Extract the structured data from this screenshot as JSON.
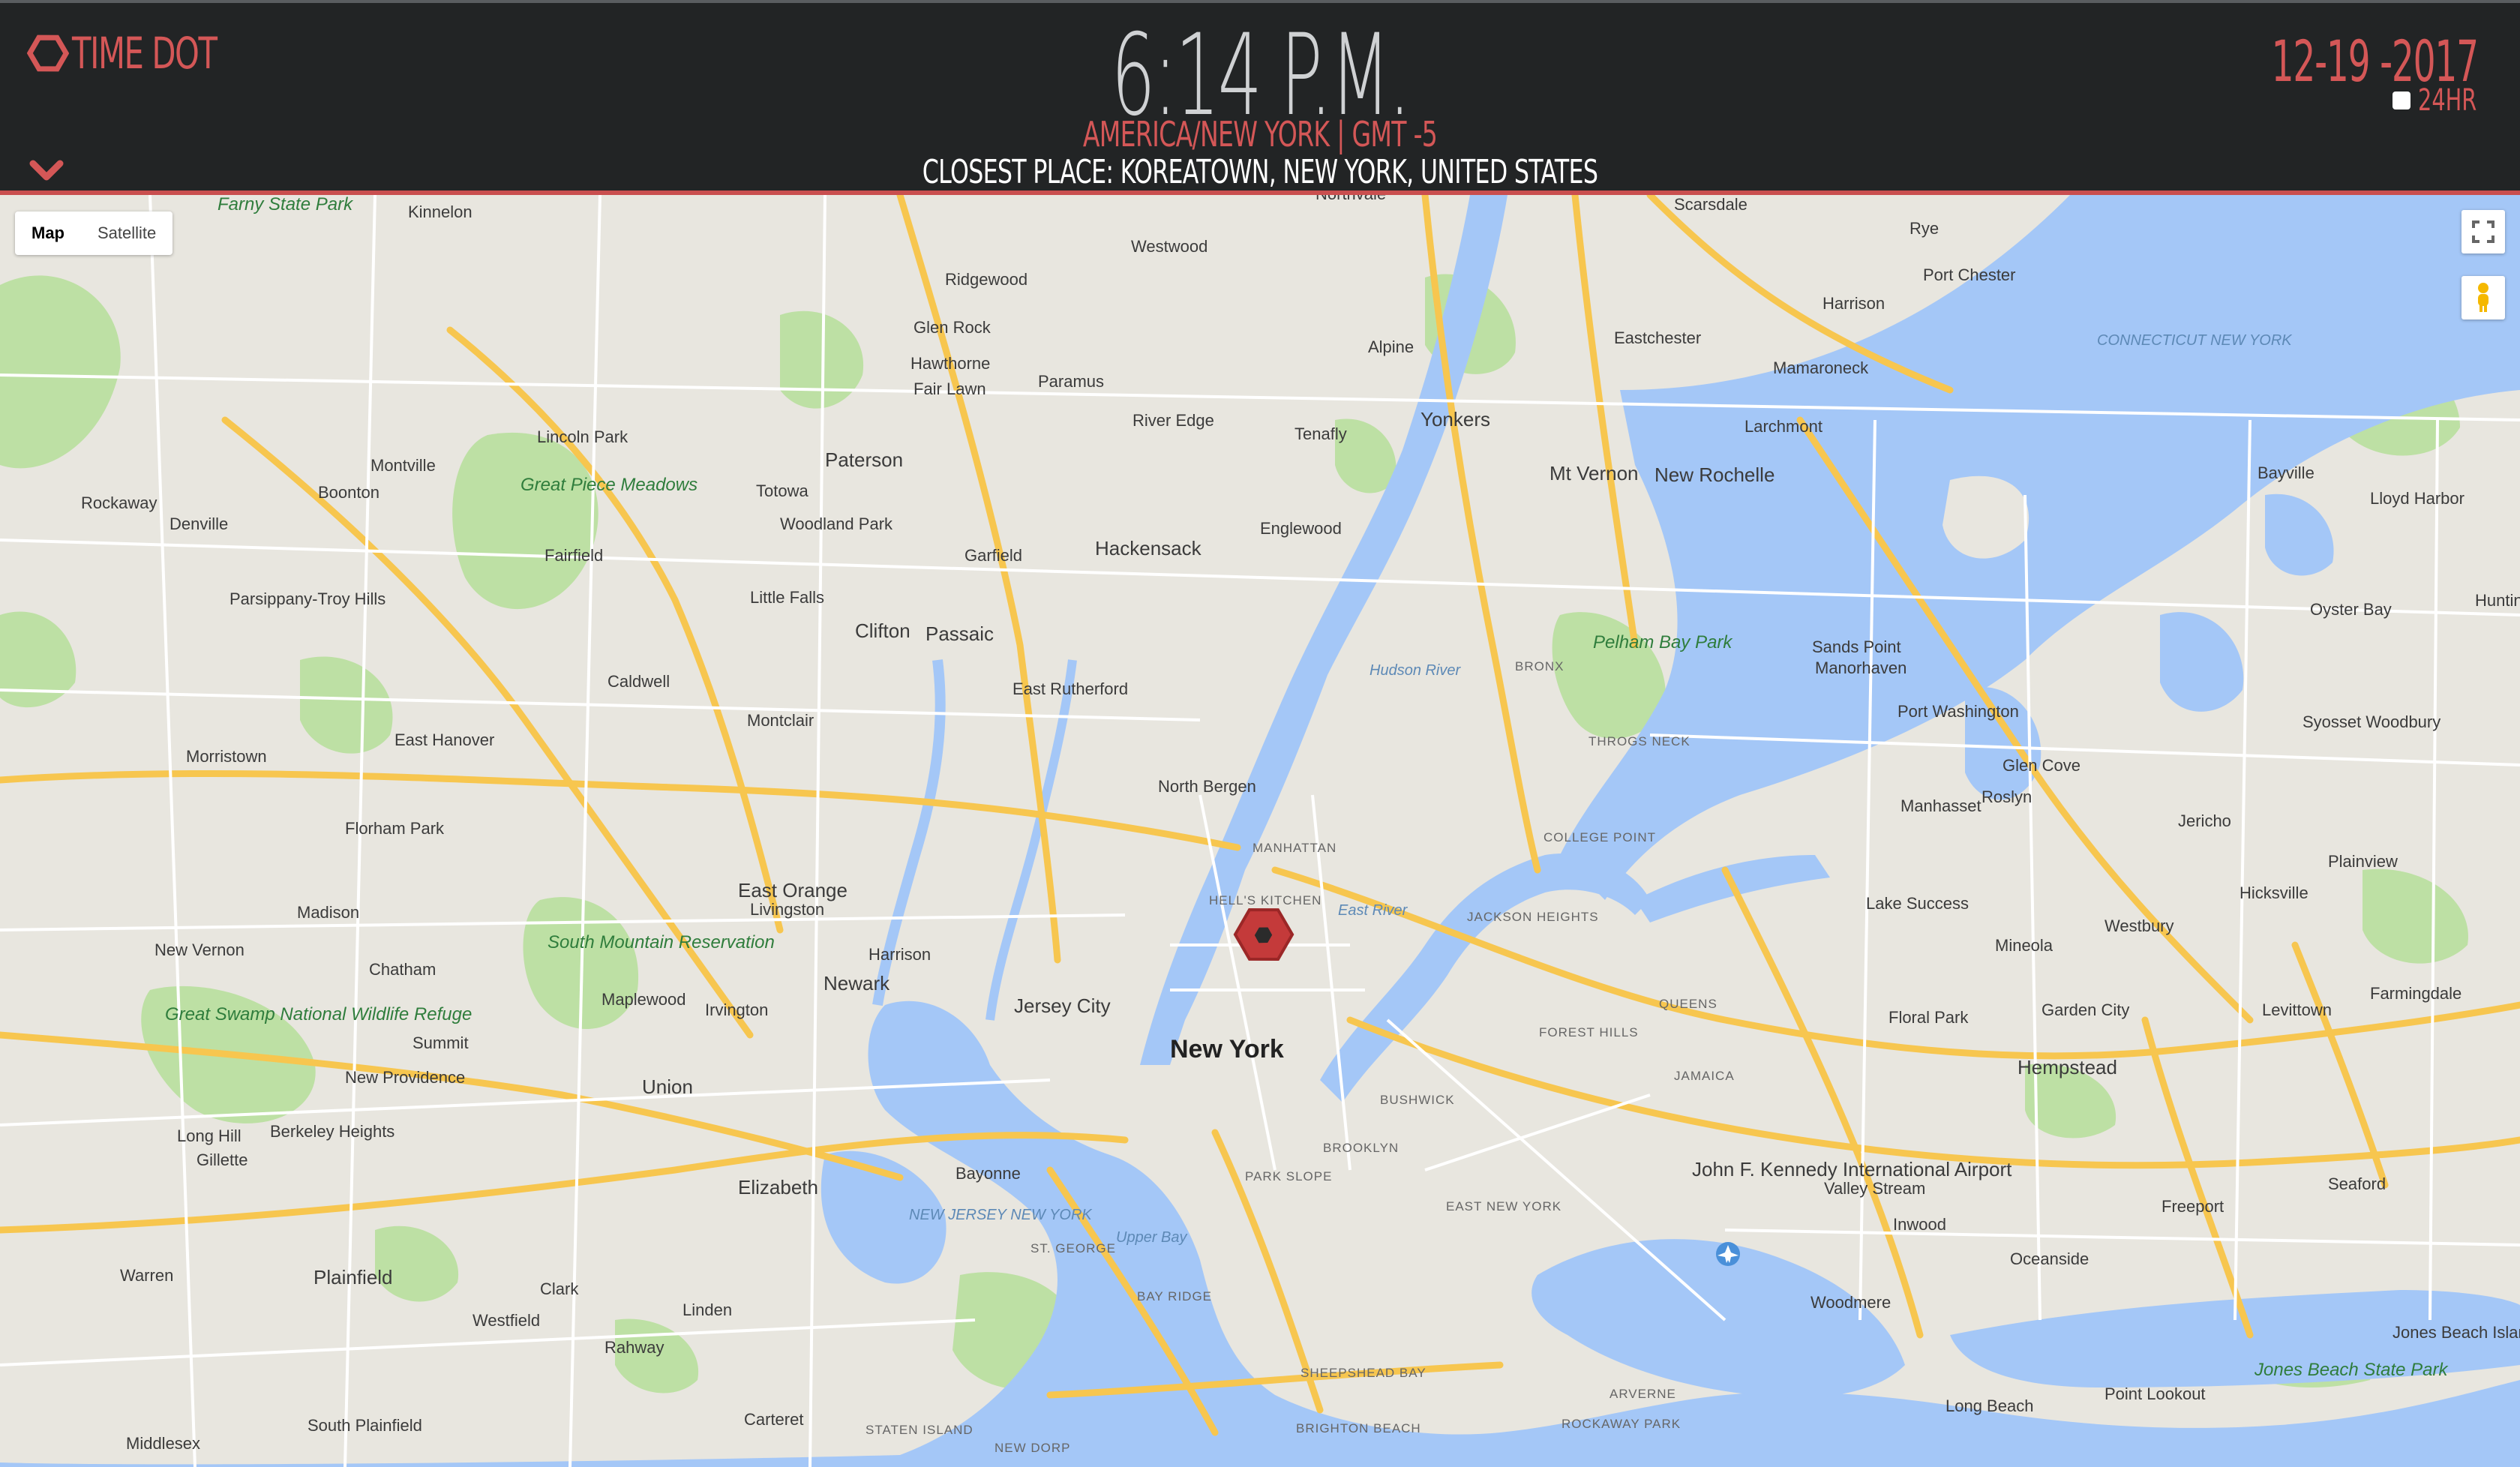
{
  "app": {
    "logo_text": "TIME DOT",
    "expand_icon": "chevron-down-icon"
  },
  "clock": {
    "time": "6:14 P.M.",
    "timezone": "AMERICA/NEW YORK | GMT -5",
    "closest_place": "CLOSEST PLACE: KOREATOWN, NEW YORK, UNITED STATES",
    "date": "12-19 -2017",
    "format_label": "24HR",
    "format_24hr_checked": false
  },
  "colors": {
    "accent": "#d45757",
    "header_bg": "#222425",
    "water": "#a4c7f7",
    "land": "#e8e6df",
    "park": "#bde0a4",
    "highway": "#f7c64f",
    "road": "#ffffff"
  },
  "map": {
    "type_controls": {
      "map": "Map",
      "satellite": "Satellite",
      "selected": "Map"
    },
    "controls": [
      "fullscreen-icon",
      "pegman-icon"
    ],
    "marker_icon": "hexagon-marker-icon",
    "labels": {
      "new_york": "New York",
      "manhattan": "MANHATTAN",
      "hells_kitchen": "HELL'S KITCHEN",
      "brooklyn": "BROOKLYN",
      "queens": "QUEENS",
      "jersey_city": "Jersey City",
      "newark": "Newark",
      "yonkers": "Yonkers",
      "paterson": "Paterson",
      "hackensack": "Hackensack",
      "new_rochelle": "New Rochelle",
      "mt_vernon": "Mt Vernon",
      "hempstead": "Hempstead",
      "jfk": "John F. Kennedy International Airport",
      "elizabeth": "Elizabeth",
      "bayonne": "Bayonne",
      "clifton": "Clifton",
      "passaic": "Passaic",
      "east_orange": "East Orange",
      "union": "Union",
      "plainfield": "Plainfield",
      "long_beach": "Long Beach",
      "hicksville": "Hicksville",
      "mineola": "Mineola",
      "westbury": "Westbury",
      "garden_city": "Garden City",
      "levittown": "Levittown",
      "valley_stream": "Valley Stream",
      "freeport": "Freeport",
      "floral_park": "Floral Park",
      "glen_cove": "Glen Cove",
      "port_washington": "Port Washington",
      "roslyn": "Roslyn",
      "manhasset": "Manhasset",
      "lake_success": "Lake Success",
      "bayville": "Bayville",
      "oyster_bay": "Oyster Bay",
      "syosset": "Syosset Woodbury",
      "jericho": "Jericho",
      "plainview": "Plainview",
      "farmingdale": "Farmingdale",
      "seaford": "Seaford",
      "oceanside": "Oceanside",
      "woodmere": "Woodmere",
      "inwood": "Inwood",
      "point_lookout": "Point Lookout",
      "jones_beach": "Jones Beach State Park",
      "jones_beach_island": "Jones Beach Island",
      "harrison": "Harrison",
      "rye": "Rye",
      "port_chester": "Port Chester",
      "scarsdale": "Scarsdale",
      "eastchester": "Eastchester",
      "mamaroneck": "Mamaroneck",
      "larchmont": "Larchmont",
      "tenafly": "Tenafly",
      "englewood": "Englewood",
      "alpine": "Alpine",
      "paramus": "Paramus",
      "river_edge": "River Edge",
      "ridgewood": "Ridgewood",
      "westwood": "Westwood",
      "glen_rock": "Glen Rock",
      "hawthorne": "Hawthorne",
      "fair_lawn": "Fair Lawn",
      "totowa": "Totowa",
      "woodland_park": "Woodland Park",
      "garfield": "Garfield",
      "little_falls": "Little Falls",
      "montclair": "Montclair",
      "east_rutherford": "East Rutherford",
      "north_bergen": "North Bergen",
      "irvington": "Irvington",
      "maplewood": "Maplewood",
      "summit": "Summit",
      "harrison_nj": "Harrison",
      "linden": "Linden",
      "rahway": "Rahway",
      "clark": "Clark",
      "westfield": "Westfield",
      "warren": "Warren",
      "livingston": "Livingston",
      "caldwell": "Caldwell",
      "fairfield": "Fairfield",
      "montville": "Montville",
      "boonton": "Boonton",
      "denville": "Denville",
      "rockaway": "Rockaway",
      "lincoln_park": "Lincoln Park",
      "kinnelon": "Kinnelon",
      "parsippany": "Parsippany-Troy Hills",
      "east_hanover": "East Hanover",
      "morristown": "Morristown",
      "florham_park": "Florham Park",
      "madison": "Madison",
      "chatham": "Chatham",
      "new_vernon": "New Vernon",
      "new_providence": "New Providence",
      "berkeley_heights": "Berkeley Heights",
      "long_hill": "Long Hill",
      "gillette": "Gillette",
      "carteret": "Carteret",
      "south_plainfield": "South Plainfield",
      "middlesex": "Middlesex",
      "bronx": "BRONX",
      "college_point": "COLLEGE POINT",
      "jackson_heights": "JACKSON HEIGHTS",
      "forest_hills": "FOREST HILLS",
      "jamaica": "JAMAICA",
      "bushwick": "BUSHWICK",
      "park_slope": "PARK SLOPE",
      "east_new_york": "EAST NEW YORK",
      "bay_ridge": "BAY RIDGE",
      "sheepshead_bay": "SHEEPSHEAD BAY",
      "brighton_beach": "BRIGHTON BEACH",
      "rockaway_park": "ROCKAWAY PARK",
      "arverne": "ARVERNE",
      "st_george": "ST. GEORGE",
      "staten_island": "STATEN ISLAND",
      "new_dorp": "NEW DORP",
      "throgs_neck": "THROGS NECK",
      "sands_point": "Sands Point",
      "manorhaven": "Manorhaven",
      "lloyd_harbor": "Lloyd Harbor",
      "huntington": "Hunting",
      "northvale": "Northvale",
      "great_piece_meadows": "Great Piece Meadows",
      "pelham_bay_park": "Pelham Bay Park",
      "south_mountain": "South Mountain Reservation",
      "great_swamp": "Great Swamp National Wildlife Refuge",
      "farny_state_park": "Farny State Park",
      "connecticut_ny": "CONNECTICUT NEW YORK",
      "new_jersey_ny": "NEW JERSEY NEW YORK",
      "hudson_river": "Hudson River",
      "upper_bay": "Upper Bay",
      "east_river": "East River"
    }
  }
}
